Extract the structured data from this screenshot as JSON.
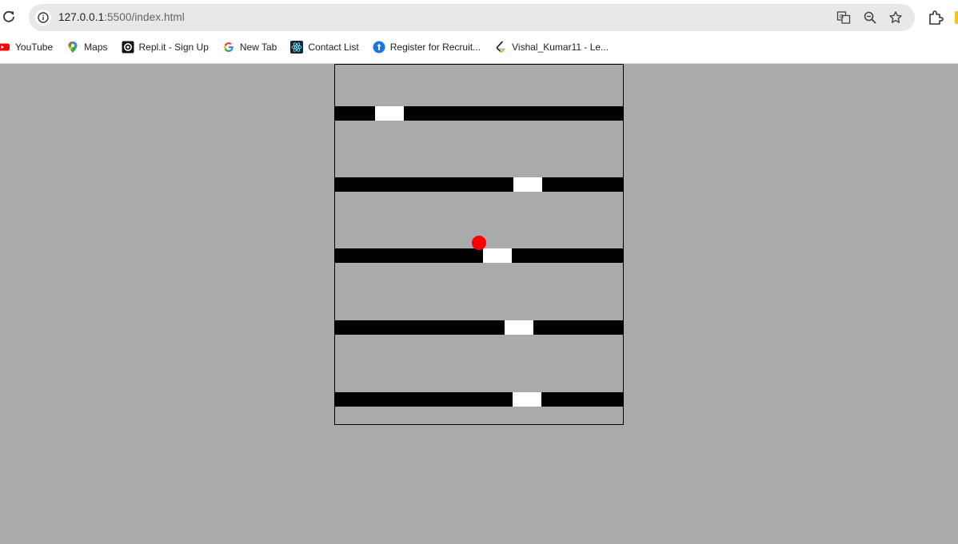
{
  "browser": {
    "url_host": "127.0.0.1",
    "url_path": ":5500/index.html",
    "bookmarks": [
      {
        "label": "YouTube",
        "icon": "youtube-icon"
      },
      {
        "label": "Maps",
        "icon": "maps-icon"
      },
      {
        "label": "Repl.it - Sign Up",
        "icon": "replit-icon"
      },
      {
        "label": "New Tab",
        "icon": "google-icon"
      },
      {
        "label": "Contact List",
        "icon": "react-icon"
      },
      {
        "label": "Register for Recruit...",
        "icon": "register-icon"
      },
      {
        "label": "Vishal_Kumar11 - Le...",
        "icon": "leetcode-icon"
      }
    ]
  },
  "game": {
    "background": "#a9aaac",
    "floor_color": "#000000",
    "hole_color": "#ffffff",
    "ball_color": "#ff0000"
  }
}
